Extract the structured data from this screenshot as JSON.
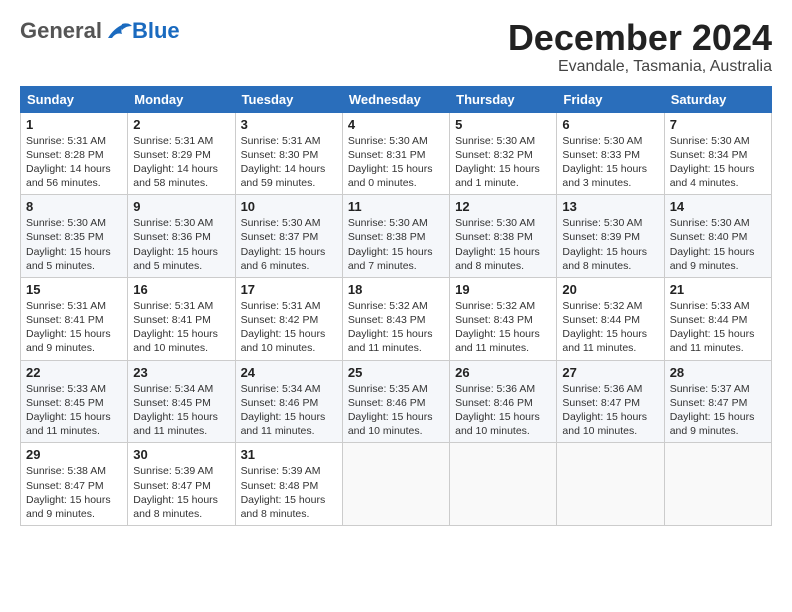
{
  "header": {
    "logo_general": "General",
    "logo_blue": "Blue",
    "month_title": "December 2024",
    "location": "Evandale, Tasmania, Australia"
  },
  "days_of_week": [
    "Sunday",
    "Monday",
    "Tuesday",
    "Wednesday",
    "Thursday",
    "Friday",
    "Saturday"
  ],
  "weeks": [
    [
      {
        "day": "1",
        "info": "Sunrise: 5:31 AM\nSunset: 8:28 PM\nDaylight: 14 hours\nand 56 minutes."
      },
      {
        "day": "2",
        "info": "Sunrise: 5:31 AM\nSunset: 8:29 PM\nDaylight: 14 hours\nand 58 minutes."
      },
      {
        "day": "3",
        "info": "Sunrise: 5:31 AM\nSunset: 8:30 PM\nDaylight: 14 hours\nand 59 minutes."
      },
      {
        "day": "4",
        "info": "Sunrise: 5:30 AM\nSunset: 8:31 PM\nDaylight: 15 hours\nand 0 minutes."
      },
      {
        "day": "5",
        "info": "Sunrise: 5:30 AM\nSunset: 8:32 PM\nDaylight: 15 hours\nand 1 minute."
      },
      {
        "day": "6",
        "info": "Sunrise: 5:30 AM\nSunset: 8:33 PM\nDaylight: 15 hours\nand 3 minutes."
      },
      {
        "day": "7",
        "info": "Sunrise: 5:30 AM\nSunset: 8:34 PM\nDaylight: 15 hours\nand 4 minutes."
      }
    ],
    [
      {
        "day": "8",
        "info": "Sunrise: 5:30 AM\nSunset: 8:35 PM\nDaylight: 15 hours\nand 5 minutes."
      },
      {
        "day": "9",
        "info": "Sunrise: 5:30 AM\nSunset: 8:36 PM\nDaylight: 15 hours\nand 5 minutes."
      },
      {
        "day": "10",
        "info": "Sunrise: 5:30 AM\nSunset: 8:37 PM\nDaylight: 15 hours\nand 6 minutes."
      },
      {
        "day": "11",
        "info": "Sunrise: 5:30 AM\nSunset: 8:38 PM\nDaylight: 15 hours\nand 7 minutes."
      },
      {
        "day": "12",
        "info": "Sunrise: 5:30 AM\nSunset: 8:38 PM\nDaylight: 15 hours\nand 8 minutes."
      },
      {
        "day": "13",
        "info": "Sunrise: 5:30 AM\nSunset: 8:39 PM\nDaylight: 15 hours\nand 8 minutes."
      },
      {
        "day": "14",
        "info": "Sunrise: 5:30 AM\nSunset: 8:40 PM\nDaylight: 15 hours\nand 9 minutes."
      }
    ],
    [
      {
        "day": "15",
        "info": "Sunrise: 5:31 AM\nSunset: 8:41 PM\nDaylight: 15 hours\nand 9 minutes."
      },
      {
        "day": "16",
        "info": "Sunrise: 5:31 AM\nSunset: 8:41 PM\nDaylight: 15 hours\nand 10 minutes."
      },
      {
        "day": "17",
        "info": "Sunrise: 5:31 AM\nSunset: 8:42 PM\nDaylight: 15 hours\nand 10 minutes."
      },
      {
        "day": "18",
        "info": "Sunrise: 5:32 AM\nSunset: 8:43 PM\nDaylight: 15 hours\nand 11 minutes."
      },
      {
        "day": "19",
        "info": "Sunrise: 5:32 AM\nSunset: 8:43 PM\nDaylight: 15 hours\nand 11 minutes."
      },
      {
        "day": "20",
        "info": "Sunrise: 5:32 AM\nSunset: 8:44 PM\nDaylight: 15 hours\nand 11 minutes."
      },
      {
        "day": "21",
        "info": "Sunrise: 5:33 AM\nSunset: 8:44 PM\nDaylight: 15 hours\nand 11 minutes."
      }
    ],
    [
      {
        "day": "22",
        "info": "Sunrise: 5:33 AM\nSunset: 8:45 PM\nDaylight: 15 hours\nand 11 minutes."
      },
      {
        "day": "23",
        "info": "Sunrise: 5:34 AM\nSunset: 8:45 PM\nDaylight: 15 hours\nand 11 minutes."
      },
      {
        "day": "24",
        "info": "Sunrise: 5:34 AM\nSunset: 8:46 PM\nDaylight: 15 hours\nand 11 minutes."
      },
      {
        "day": "25",
        "info": "Sunrise: 5:35 AM\nSunset: 8:46 PM\nDaylight: 15 hours\nand 10 minutes."
      },
      {
        "day": "26",
        "info": "Sunrise: 5:36 AM\nSunset: 8:46 PM\nDaylight: 15 hours\nand 10 minutes."
      },
      {
        "day": "27",
        "info": "Sunrise: 5:36 AM\nSunset: 8:47 PM\nDaylight: 15 hours\nand 10 minutes."
      },
      {
        "day": "28",
        "info": "Sunrise: 5:37 AM\nSunset: 8:47 PM\nDaylight: 15 hours\nand 9 minutes."
      }
    ],
    [
      {
        "day": "29",
        "info": "Sunrise: 5:38 AM\nSunset: 8:47 PM\nDaylight: 15 hours\nand 9 minutes."
      },
      {
        "day": "30",
        "info": "Sunrise: 5:39 AM\nSunset: 8:47 PM\nDaylight: 15 hours\nand 8 minutes."
      },
      {
        "day": "31",
        "info": "Sunrise: 5:39 AM\nSunset: 8:48 PM\nDaylight: 15 hours\nand 8 minutes."
      },
      null,
      null,
      null,
      null
    ]
  ]
}
